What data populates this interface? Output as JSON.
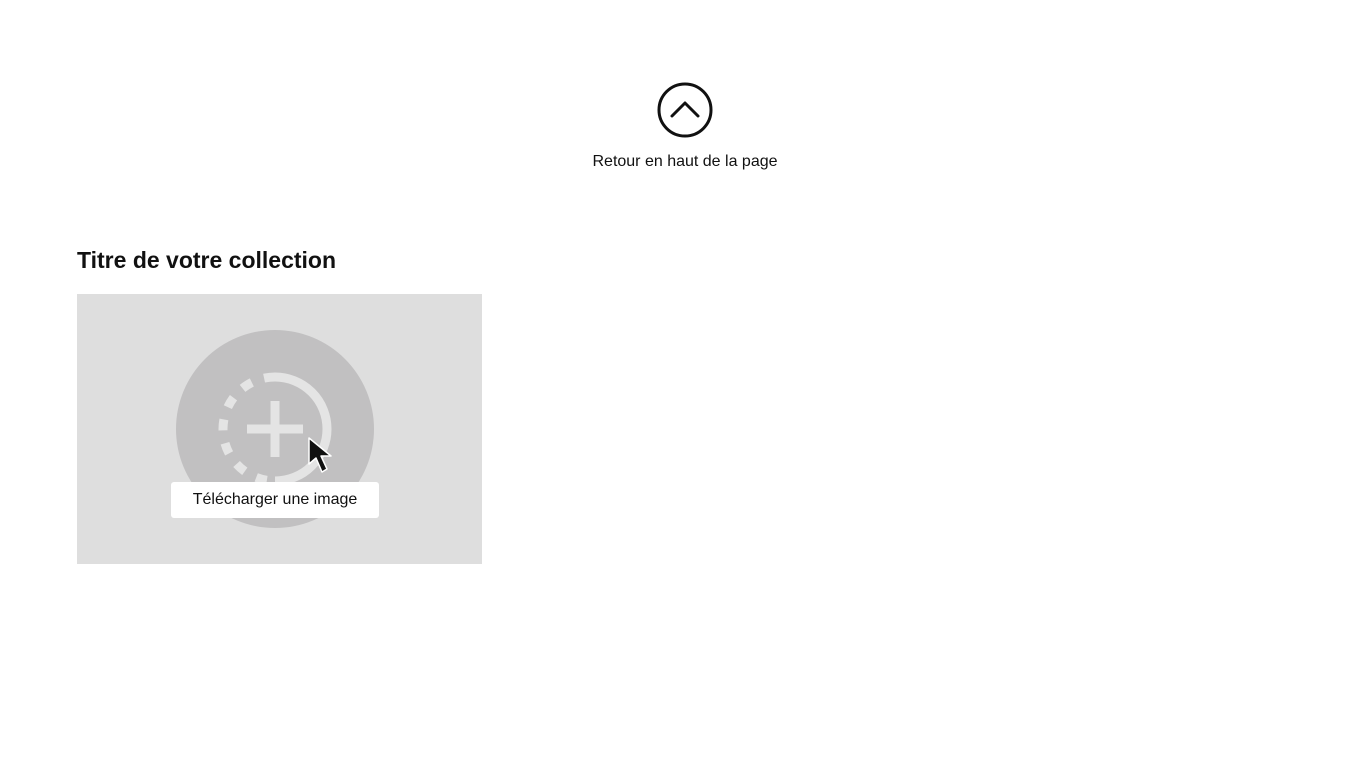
{
  "back_to_top": {
    "label": "Retour en haut de la page",
    "icon": "chevron-up-circle-icon"
  },
  "collection": {
    "title": "Titre de votre collection",
    "upload_label": "Télécharger une image",
    "upload_icon": "add-image-icon"
  },
  "colors": {
    "background": "#ffffff",
    "text": "#111111",
    "card_background": "#dedede",
    "circle": "#c1c0c1",
    "icon_stroke": "#e4e4e4"
  }
}
